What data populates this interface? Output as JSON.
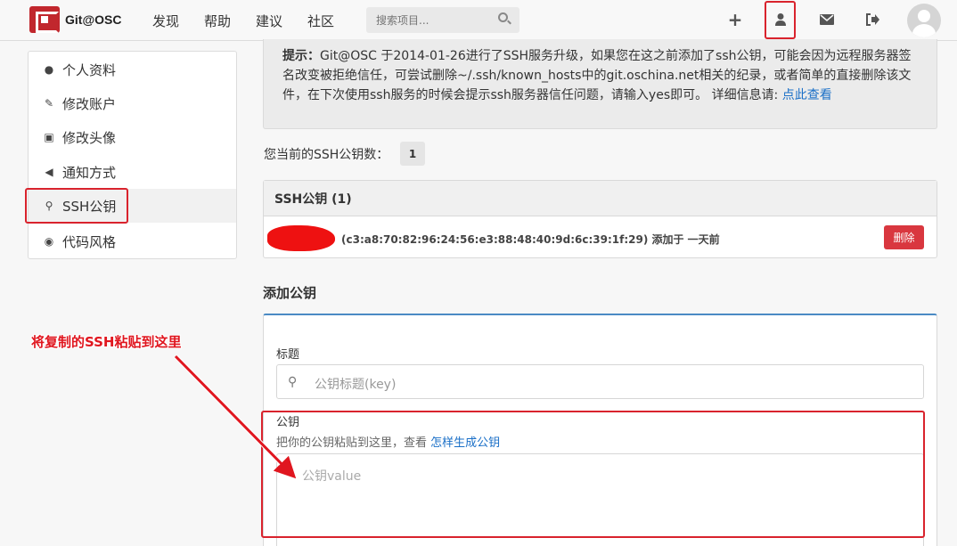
{
  "header": {
    "brand": "Git@OSC",
    "nav": [
      "发现",
      "帮助",
      "建议",
      "社区"
    ],
    "search_placeholder": "搜索项目...",
    "icons": [
      "plus-icon",
      "user-icon",
      "mail-icon",
      "logout-icon"
    ]
  },
  "sidebar": {
    "items": [
      {
        "label": "个人资料",
        "icon": "user-icon"
      },
      {
        "label": "修改账户",
        "icon": "pencil-icon"
      },
      {
        "label": "修改头像",
        "icon": "camera-icon"
      },
      {
        "label": "通知方式",
        "icon": "volume-icon"
      },
      {
        "label": "SSH公钥",
        "icon": "key-icon"
      },
      {
        "label": "代码风格",
        "icon": "dashboard-icon"
      }
    ],
    "active": "SSH公钥"
  },
  "notice": {
    "prefix": "提示：",
    "text": "Git@OSC 于2014-01-26进行了SSH服务升级，如果您在这之前添加了ssh公钥，可能会因为远程服务器签名改变被拒绝信任，可尝试删除~/.ssh/known_hosts中的git.oschina.net相关的纪录，或者简单的直接删除该文件，在下次使用ssh服务的时候会提示ssh服务器信任问题，请输入yes即可。 详细信息请: ",
    "link": "点此查看"
  },
  "keys": {
    "count_label": "您当前的SSH公钥数：",
    "count": "1",
    "panel_title": "SSH公钥 (1)",
    "entry": "(c3:a8:70:82:96:24:56:e3:88:48:40:9d:6c:39:1f:29) 添加于 一天前",
    "delete_label": "删除"
  },
  "add_key": {
    "section_title": "添加公钥",
    "title_label": "标题",
    "title_placeholder": "公钥标题(key)",
    "key_label": "公钥",
    "key_help": "把你的公钥粘贴到这里，查看 ",
    "key_help_link": "怎样生成公钥",
    "key_placeholder": "公钥value"
  },
  "annotation": "将复制的SSH粘贴到这里",
  "colors": {
    "accent": "#d9232d",
    "link": "#1a6fc7",
    "form_top": "#4a8ac4"
  }
}
